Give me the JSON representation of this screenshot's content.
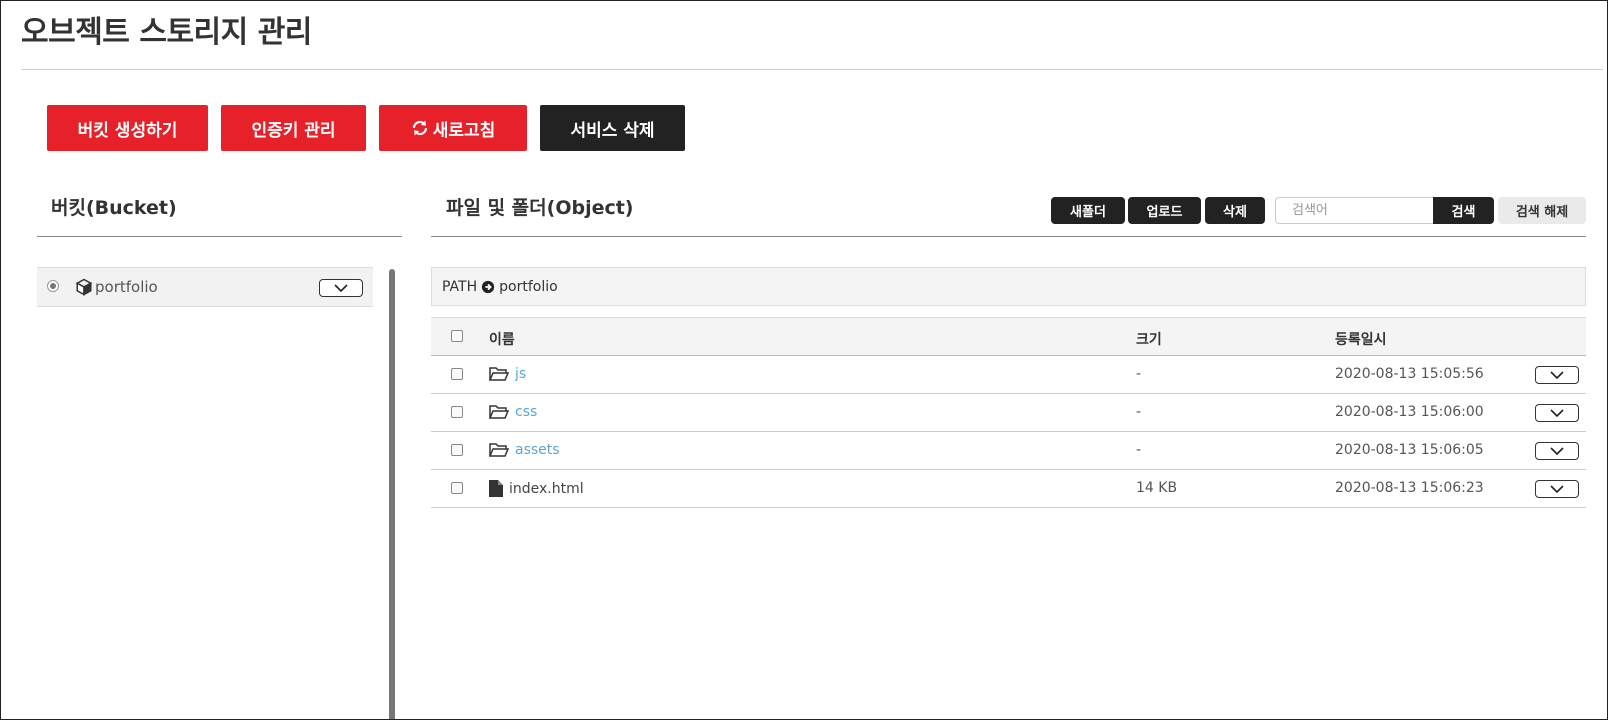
{
  "page": {
    "title": "오브젝트 스토리지 관리"
  },
  "actions": {
    "create_bucket": "버킷 생성하기",
    "auth_key": "인증키 관리",
    "refresh": "새로고침",
    "delete_service": "서비스 삭제"
  },
  "bucket_panel": {
    "title": "버킷(Bucket)",
    "buckets": [
      {
        "name": "portfolio",
        "selected": true
      }
    ]
  },
  "object_panel": {
    "title": "파일 및 폴더(Object)",
    "toolbar": {
      "new_folder": "새폴더",
      "upload": "업로드",
      "delete": "삭제",
      "search_placeholder": "검색어",
      "search": "검색",
      "reset_search": "검색 해제"
    },
    "path_label": "PATH",
    "path_value": "portfolio",
    "columns": {
      "name": "이름",
      "size": "크기",
      "date": "등록일시"
    },
    "rows": [
      {
        "name": "js",
        "type": "folder",
        "size": "-",
        "date": "2020-08-13 15:05:56"
      },
      {
        "name": "css",
        "type": "folder",
        "size": "-",
        "date": "2020-08-13 15:06:00"
      },
      {
        "name": "assets",
        "type": "folder",
        "size": "-",
        "date": "2020-08-13 15:06:05"
      },
      {
        "name": "index.html",
        "type": "file",
        "size": "14 KB",
        "date": "2020-08-13 15:06:23"
      }
    ]
  },
  "colors": {
    "accent_red": "#e62129",
    "dark_button": "#222222",
    "link_blue": "#5aa5d8"
  },
  "icons": {
    "refresh": "refresh-icon",
    "bucket": "cube-icon",
    "folder": "folder-open-icon",
    "file": "file-icon",
    "path_arrow": "arrow-circle-right-icon",
    "dropdown": "chevron-down-icon"
  }
}
